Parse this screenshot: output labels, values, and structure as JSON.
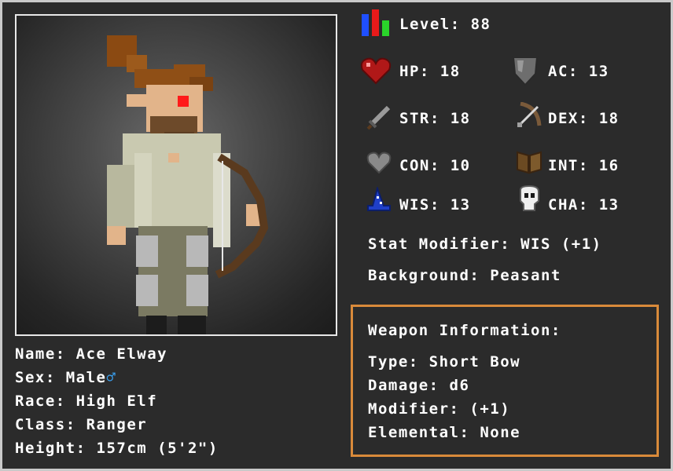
{
  "character": {
    "name_label": "Name:",
    "name": "Ace Elway",
    "sex_label": "Sex:",
    "sex": "Male",
    "sex_symbol": "♂",
    "race_label": "Race:",
    "race": "High Elf",
    "class_label": "Class:",
    "class": "Ranger",
    "height_label": "Height:",
    "height": "157cm (5'2\")"
  },
  "stats": {
    "level_label": "Level:",
    "level": "88",
    "hp_label": "HP:",
    "hp": "18",
    "ac_label": "AC:",
    "ac": "13",
    "str_label": "STR:",
    "str": "18",
    "dex_label": "DEX:",
    "dex": "18",
    "con_label": "CON:",
    "con": "10",
    "int_label": "INT:",
    "int": "16",
    "wis_label": "WIS:",
    "wis": "13",
    "cha_label": "CHA:",
    "cha": "13",
    "modifier_label": "Stat Modifier:",
    "modifier": "WIS (+1)",
    "background_label": "Background:",
    "background": "Peasant"
  },
  "weapon": {
    "title": "Weapon Information:",
    "type_label": "Type:",
    "type": "Short Bow",
    "damage_label": "Damage:",
    "damage": "d6",
    "modifier_label": "Modifier:",
    "modifier": "(+1)",
    "elemental_label": "Elemental:",
    "elemental": "None"
  },
  "icons": {
    "level": "level-bars-icon",
    "hp": "heart-icon",
    "ac": "shield-icon",
    "str": "sword-icon",
    "dex": "bow-arrow-icon",
    "con": "grey-heart-icon",
    "int": "book-icon",
    "wis": "wizard-hat-icon",
    "cha": "skull-icon",
    "sex": "male-symbol-icon"
  },
  "colors": {
    "background": "#2b2b2b",
    "frame": "#c9c9c9",
    "weapon_border": "#d98a3a",
    "male_symbol": "#3aa0f0"
  }
}
